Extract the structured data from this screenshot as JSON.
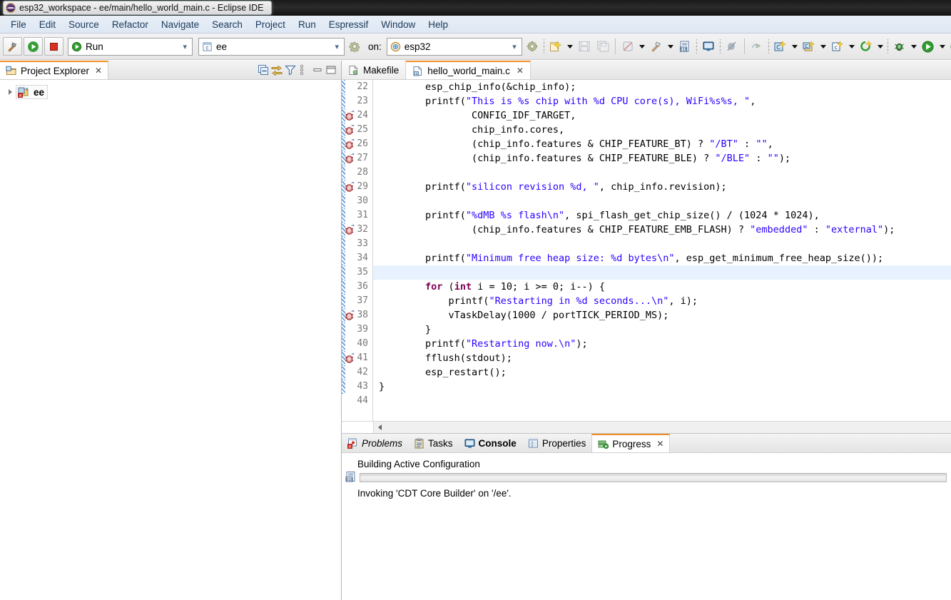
{
  "window": {
    "title": "esp32_workspace - ee/main/hello_world_main.c - Eclipse IDE",
    "app_icon": "eclipse-icon"
  },
  "menubar": {
    "items": [
      {
        "label": "File"
      },
      {
        "label": "Edit"
      },
      {
        "label": "Source"
      },
      {
        "label": "Refactor"
      },
      {
        "label": "Navigate"
      },
      {
        "label": "Search"
      },
      {
        "label": "Project"
      },
      {
        "label": "Run"
      },
      {
        "label": "Espressif"
      },
      {
        "label": "Window"
      },
      {
        "label": "Help"
      }
    ]
  },
  "toolbar": {
    "build_button": "hammer-icon",
    "run_button": "run-green-icon",
    "stop_button": "stop-red-icon",
    "launch_mode": {
      "value": "Run",
      "icon": "run-green-icon"
    },
    "launch_config": {
      "value": "ee",
      "icon": "c-project-icon"
    },
    "on_label": "on:",
    "target": {
      "value": "esp32",
      "icon": "target-icon"
    },
    "icons": [
      "new-file-icon",
      "save-icon",
      "save-all-icon",
      "no-build-icon",
      "hammer-icon",
      "binary-icon",
      "open-console-icon",
      "skip-breakpoints-icon",
      "resume-icon",
      "new-c-project-icon",
      "new-c-class-icon",
      "new-c-file-icon",
      "new-element-icon",
      "debug-icon",
      "run-icon",
      "run-last-icon"
    ]
  },
  "project_explorer": {
    "tab_label": "Project Explorer",
    "tab_icon": "project-explorer-icon",
    "close_icon": "close-icon",
    "tools": [
      {
        "name": "collapse-all-icon"
      },
      {
        "name": "link-with-editor-icon"
      },
      {
        "name": "filter-icon"
      },
      {
        "name": "view-menu-icon"
      },
      {
        "name": "minimize-icon"
      },
      {
        "name": "maximize-icon"
      }
    ],
    "tree": [
      {
        "label": "ee",
        "icon": "c-project-error-icon",
        "expanded": false,
        "selected": true
      }
    ]
  },
  "editor": {
    "tabs": [
      {
        "label": "Makefile",
        "icon": "makefile-icon",
        "active": false,
        "closeable": false
      },
      {
        "label": "hello_world_main.c",
        "icon": "c-file-icon",
        "active": true,
        "closeable": true
      }
    ],
    "current_line": 35,
    "first_line": 22,
    "last_line": 44,
    "colors": {
      "string": "#2a00ff",
      "keyword": "#7f0055",
      "comment": "#3f7f5f",
      "current_line_bg": "#e8f2fe",
      "accent": "#f08d26"
    },
    "lines": [
      {
        "n": 22,
        "marker": false,
        "dirty": true,
        "code": "        esp_chip_info(&chip_info);"
      },
      {
        "n": 23,
        "marker": false,
        "dirty": true,
        "code": "        printf(\"This is %s chip with %d CPU core(s), WiFi%s%s, \","
      },
      {
        "n": 24,
        "marker": true,
        "dirty": true,
        "code": "                CONFIG_IDF_TARGET,"
      },
      {
        "n": 25,
        "marker": true,
        "dirty": true,
        "code": "                chip_info.cores,"
      },
      {
        "n": 26,
        "marker": true,
        "dirty": true,
        "code": "                (chip_info.features & CHIP_FEATURE_BT) ? \"/BT\" : \"\","
      },
      {
        "n": 27,
        "marker": true,
        "dirty": true,
        "code": "                (chip_info.features & CHIP_FEATURE_BLE) ? \"/BLE\" : \"\");"
      },
      {
        "n": 28,
        "marker": false,
        "dirty": true,
        "code": ""
      },
      {
        "n": 29,
        "marker": true,
        "dirty": true,
        "code": "        printf(\"silicon revision %d, \", chip_info.revision);"
      },
      {
        "n": 30,
        "marker": false,
        "dirty": true,
        "code": ""
      },
      {
        "n": 31,
        "marker": false,
        "dirty": true,
        "code": "        printf(\"%dMB %s flash\\n\", spi_flash_get_chip_size() / (1024 * 1024),"
      },
      {
        "n": 32,
        "marker": true,
        "dirty": true,
        "code": "                (chip_info.features & CHIP_FEATURE_EMB_FLASH) ? \"embedded\" : \"external\");"
      },
      {
        "n": 33,
        "marker": false,
        "dirty": true,
        "code": ""
      },
      {
        "n": 34,
        "marker": false,
        "dirty": true,
        "code": "        printf(\"Minimum free heap size: %d bytes\\n\", esp_get_minimum_free_heap_size());"
      },
      {
        "n": 35,
        "marker": false,
        "dirty": true,
        "code": ""
      },
      {
        "n": 36,
        "marker": false,
        "dirty": true,
        "code": "        for (int i = 10; i >= 0; i--) {"
      },
      {
        "n": 37,
        "marker": false,
        "dirty": true,
        "code": "            printf(\"Restarting in %d seconds...\\n\", i);"
      },
      {
        "n": 38,
        "marker": true,
        "dirty": true,
        "code": "            vTaskDelay(1000 / portTICK_PERIOD_MS);"
      },
      {
        "n": 39,
        "marker": false,
        "dirty": true,
        "code": "        }"
      },
      {
        "n": 40,
        "marker": false,
        "dirty": true,
        "code": "        printf(\"Restarting now.\\n\");"
      },
      {
        "n": 41,
        "marker": true,
        "dirty": true,
        "code": "        fflush(stdout);"
      },
      {
        "n": 42,
        "marker": false,
        "dirty": true,
        "code": "        esp_restart();"
      },
      {
        "n": 43,
        "marker": false,
        "dirty": true,
        "code": "}"
      },
      {
        "n": 44,
        "marker": false,
        "dirty": false,
        "code": ""
      }
    ]
  },
  "bottom_panel": {
    "tabs": [
      {
        "label": "Problems",
        "icon": "problems-icon",
        "style": "italic",
        "active": false
      },
      {
        "label": "Tasks",
        "icon": "tasks-icon",
        "style": "normal",
        "active": false
      },
      {
        "label": "Console",
        "icon": "console-icon",
        "style": "bold",
        "active": false
      },
      {
        "label": "Properties",
        "icon": "properties-icon",
        "style": "normal",
        "active": false
      },
      {
        "label": "Progress",
        "icon": "progress-icon",
        "style": "normal",
        "active": true,
        "closeable": true
      }
    ],
    "progress": {
      "title": "Building Active Configuration",
      "job_icon": "binary-job-icon",
      "progress_percent": 0,
      "subtask": "Invoking 'CDT Core Builder' on '/ee'."
    }
  }
}
